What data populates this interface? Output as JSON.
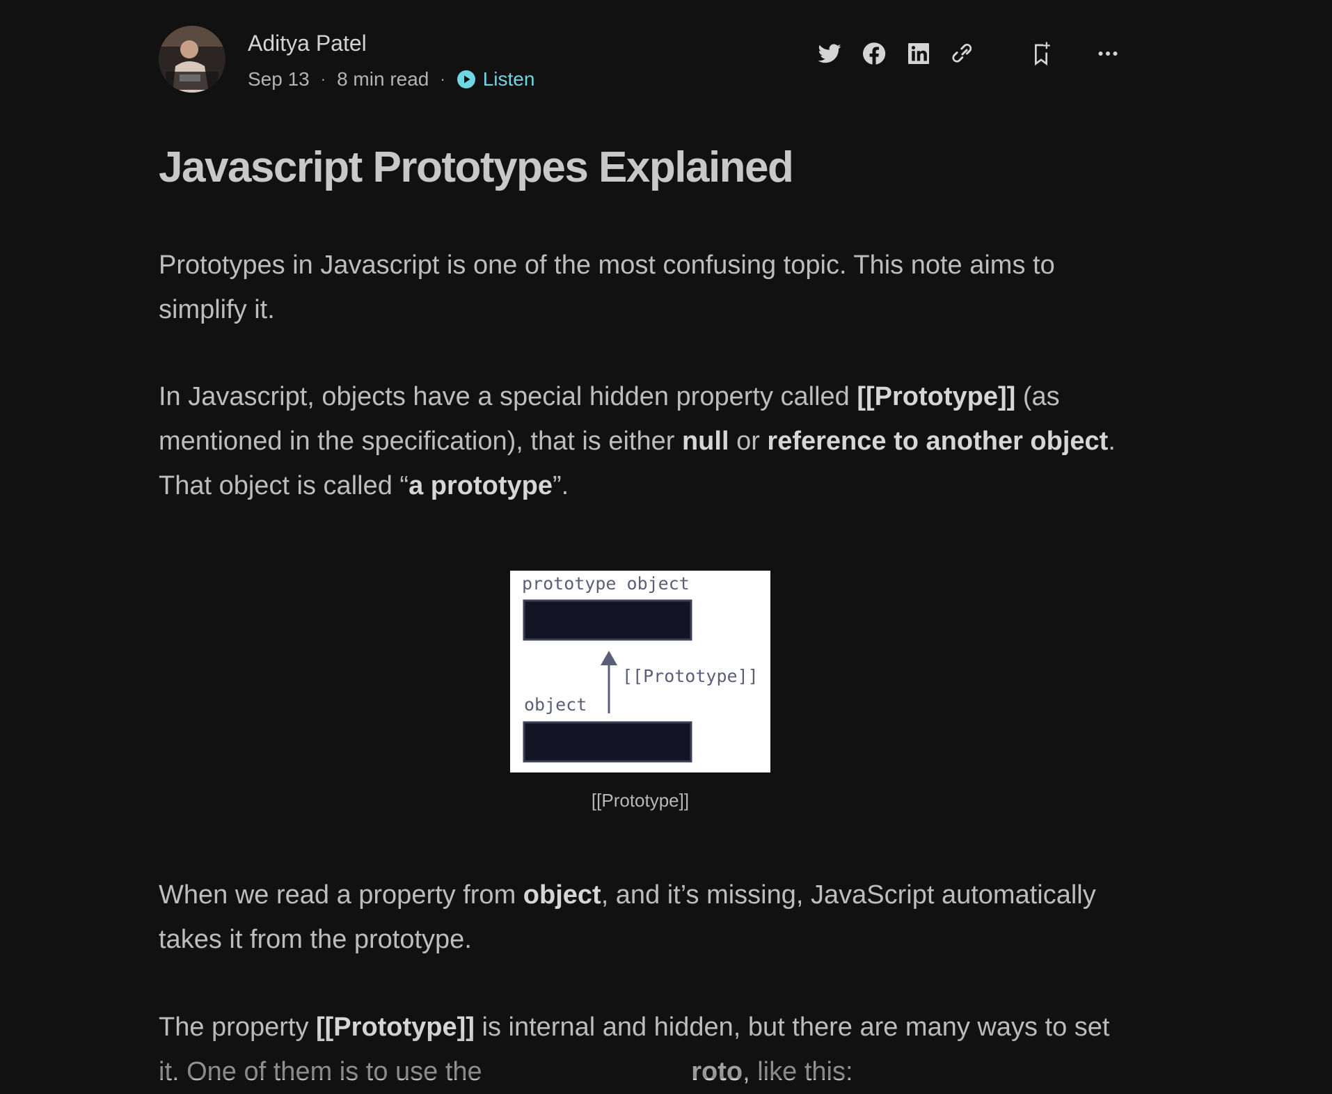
{
  "author": {
    "name": "Aditya Patel",
    "date": "Sep 13",
    "read_time": "8 min read",
    "listen_label": "Listen"
  },
  "actions": {
    "twitter": "twitter-icon",
    "facebook": "facebook-icon",
    "linkedin": "linkedin-icon",
    "link": "link-icon",
    "bookmark": "bookmark-add-icon",
    "more": "more-icon"
  },
  "colors": {
    "accent": "#6fd6e2",
    "background": "#111111",
    "text": "#bdbdbd"
  },
  "article": {
    "title": "Javascript Prototypes Explained",
    "p1": "Prototypes in Javascript is one of the most confusing topic. This note aims to simplify it.",
    "p2": {
      "t1": "In Javascript, objects have a special hidden property called ",
      "b1": "[[Prototype]]",
      "t2": " (as mentioned in the specification), that is either ",
      "b2": "null",
      "t3": " or ",
      "b3": "reference to another object",
      "t4": ". That object is called “",
      "b4": "a prototype",
      "t5": "”."
    },
    "figure": {
      "label_top": "prototype object",
      "label_arrow": "[[Prototype]]",
      "label_bottom": "object",
      "caption": "[[Prototype]]"
    },
    "p3": {
      "t1": "When we read a property from ",
      "b1": "object",
      "t2": ", and it’s missing, JavaScript automatically takes it from the prototype."
    },
    "p4": {
      "t1": "The property ",
      "b1": "[[Prototype]]",
      "t2": " is internal and hidden, but there are many ways to set it. One of them is to use the ",
      "t3": "roto",
      "t4": ", like this:"
    }
  }
}
